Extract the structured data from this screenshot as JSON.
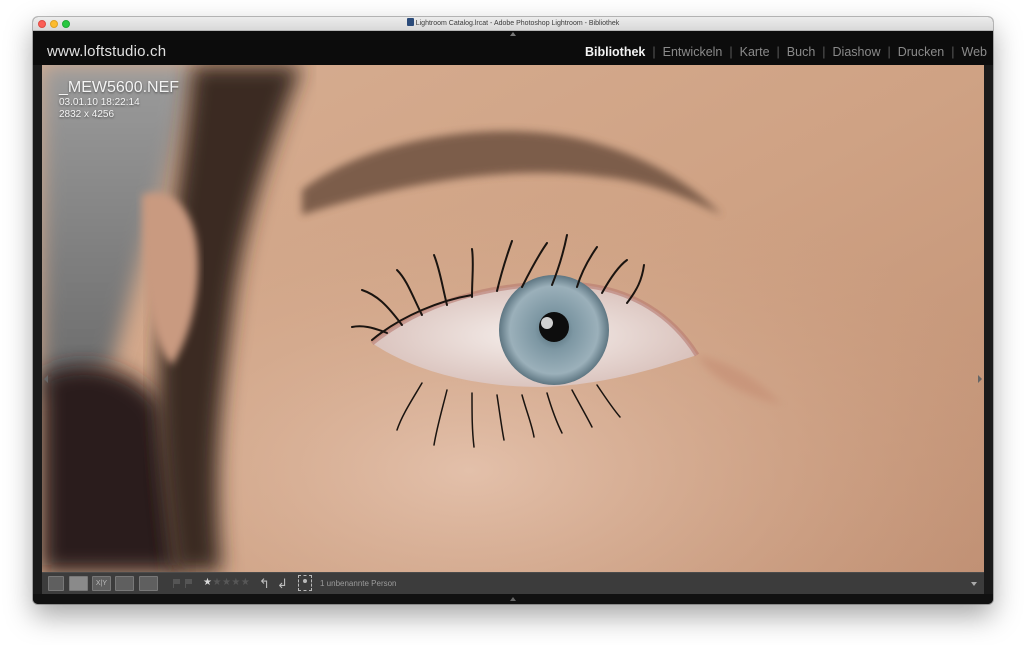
{
  "window": {
    "title": "Lightroom Catalog.lrcat - Adobe Photoshop Lightroom - Bibliothek",
    "traffic_lights": [
      "close",
      "minimize",
      "zoom"
    ]
  },
  "header": {
    "identity_plate": "www.loftstudio.ch",
    "modules": [
      {
        "label": "Bibliothek",
        "active": true
      },
      {
        "label": "Entwickeln",
        "active": false
      },
      {
        "label": "Karte",
        "active": false
      },
      {
        "label": "Buch",
        "active": false
      },
      {
        "label": "Diashow",
        "active": false
      },
      {
        "label": "Drucken",
        "active": false
      },
      {
        "label": "Web",
        "active": false
      }
    ]
  },
  "photo": {
    "filename": "_MEW5600.NEF",
    "date": "03.01.10 18:22:14",
    "dimensions": "2832 x 4256",
    "subject_icon": "close-up-eye-photo"
  },
  "toolbar": {
    "view_buttons": [
      "grid-view-icon",
      "loupe-view-icon",
      "compare-view-icon",
      "survey-view-icon",
      "people-view-icon"
    ],
    "compare_label": "X|Y",
    "rating": 1,
    "rating_max": 5,
    "rotate_icons": [
      "rotate-left-icon",
      "rotate-right-icon"
    ],
    "face_icon": "face-region-icon",
    "person_label": "1 unbenannte Person"
  },
  "colors": {
    "topbar_bg": "#0c0c0c",
    "active_module": "#f2f2f2",
    "inactive_module": "#8a8a8a",
    "toolbar_bg": "#3c3c3c"
  }
}
